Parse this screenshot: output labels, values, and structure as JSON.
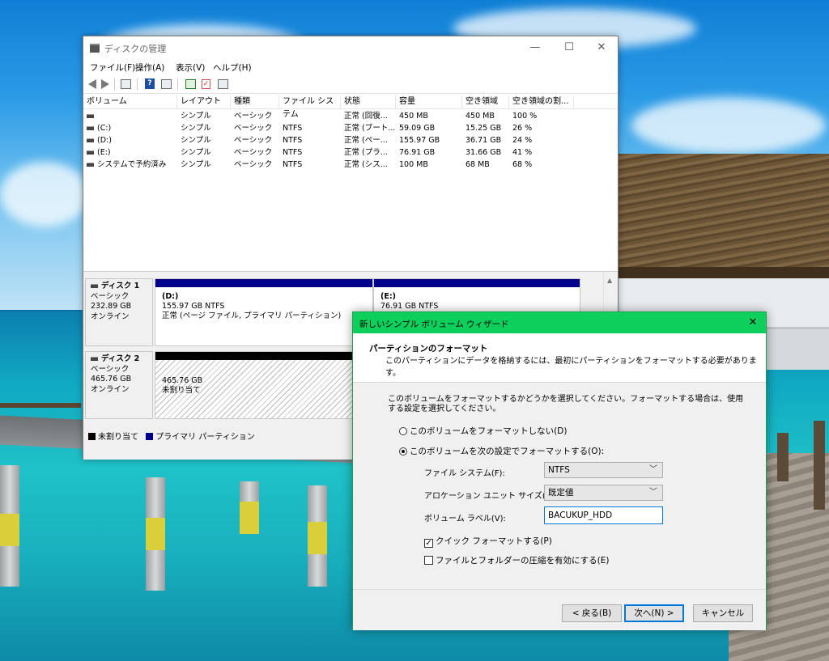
{
  "disk_management": {
    "title": "ディスクの管理",
    "window_controls": {
      "minimize": "—",
      "maximize": "☐",
      "close": "✕"
    },
    "menu": [
      "ファイル(F)",
      "操作(A)",
      "表示(V)",
      "ヘルプ(H)"
    ],
    "volume_table": {
      "columns": [
        "ボリューム",
        "レイアウト",
        "種類",
        "ファイル システム",
        "状態",
        "容量",
        "空き領域",
        "空き領域の割..."
      ],
      "rows": [
        [
          "",
          "シンプル",
          "ベーシック",
          "",
          "正常 (回復...",
          "450 MB",
          "450 MB",
          "100 %"
        ],
        [
          "(C:)",
          "シンプル",
          "ベーシック",
          "NTFS",
          "正常 (ブート...",
          "59.09 GB",
          "15.25 GB",
          "26 %"
        ],
        [
          "(D:)",
          "シンプル",
          "ベーシック",
          "NTFS",
          "正常 (ペー...",
          "155.97 GB",
          "36.71 GB",
          "24 %"
        ],
        [
          "(E:)",
          "シンプル",
          "ベーシック",
          "NTFS",
          "正常 (プラ...",
          "76.91 GB",
          "31.66 GB",
          "41 %"
        ],
        [
          "システムで予約済み",
          "シンプル",
          "ベーシック",
          "NTFS",
          "正常 (シス...",
          "100 MB",
          "68 MB",
          "68 %"
        ]
      ]
    },
    "disks": [
      {
        "name": "ディスク 1",
        "type": "ベーシック",
        "size": "232.89 GB",
        "status": "オンライン",
        "partitions": [
          {
            "label": "(D:)",
            "detail": "155.97 GB NTFS",
            "status": "正常 (ページ ファイル, プライマリ パーティション)"
          },
          {
            "label": "(E:)",
            "detail": "76.91 GB NTFS",
            "status": ""
          }
        ]
      },
      {
        "name": "ディスク 2",
        "type": "ベーシック",
        "size": "465.76 GB",
        "status": "オンライン",
        "partitions": [
          {
            "label": "465.76 GB",
            "detail": "未割り当て"
          }
        ]
      }
    ],
    "legend": [
      {
        "label": "未割り当て",
        "color": "#000000"
      },
      {
        "label": "プライマリ パーティション",
        "color": "#00008b"
      }
    ]
  },
  "wizard": {
    "title": "新しいシンプル ボリューム ウィザード",
    "close": "✕",
    "heading": "パーティションのフォーマット",
    "subheading": "このパーティションにデータを格納するには、最初にパーティションをフォーマットする必要があります。",
    "description": "このボリュームをフォーマットするかどうかを選択してください。フォーマットする場合は、使用する設定を選択してください。",
    "radio_no_format": "このボリュームをフォーマットしない(D)",
    "radio_format": "このボリュームを次の設定でフォーマットする(O):",
    "selected_radio": "format",
    "file_system_label": "ファイル システム(F):",
    "file_system_value": "NTFS",
    "allocation_label": "アロケーション ユニット サイズ(A):",
    "allocation_value": "既定値",
    "volume_label_label": "ボリューム ラベル(V):",
    "volume_label_value": "BACUKUP_HDD",
    "quick_format": "クイック フォーマットする(P)",
    "quick_format_checked": true,
    "compression": "ファイルとフォルダーの圧縮を有効にする(E)",
    "compression_checked": false,
    "buttons": {
      "back": "< 戻る(B)",
      "next": "次へ(N) >",
      "cancel": "キャンセル"
    },
    "accent_color": "#0ccf5c"
  }
}
